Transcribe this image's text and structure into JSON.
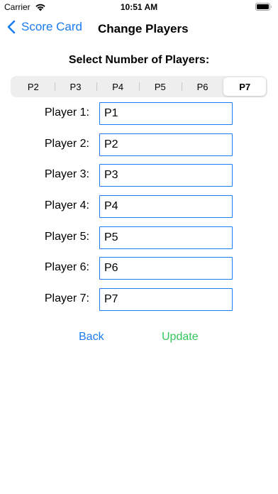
{
  "status_bar": {
    "carrier": "Carrier",
    "time": "10:51 AM",
    "icons": [
      "wifi-icon",
      "battery-icon"
    ]
  },
  "nav": {
    "back_label": "Score Card",
    "title": "Change Players",
    "back_icon": "chevron-left-icon"
  },
  "section_title": "Select Number of Players:",
  "segments": [
    "P2",
    "P3",
    "P4",
    "P5",
    "P6",
    "P7"
  ],
  "selected_segment": "P7",
  "players": [
    {
      "label": "Player 1:",
      "value": "P1"
    },
    {
      "label": "Player 2:",
      "value": "P2"
    },
    {
      "label": "Player 3:",
      "value": "P3"
    },
    {
      "label": "Player 4:",
      "value": "P4"
    },
    {
      "label": "Player 5:",
      "value": "P5"
    },
    {
      "label": "Player 6:",
      "value": "P6"
    },
    {
      "label": "Player 7:",
      "value": "P7"
    }
  ],
  "actions": {
    "back_label": "Back",
    "update_label": "Update"
  },
  "colors": {
    "accent": "#1a7cf2",
    "update": "#34c759"
  }
}
